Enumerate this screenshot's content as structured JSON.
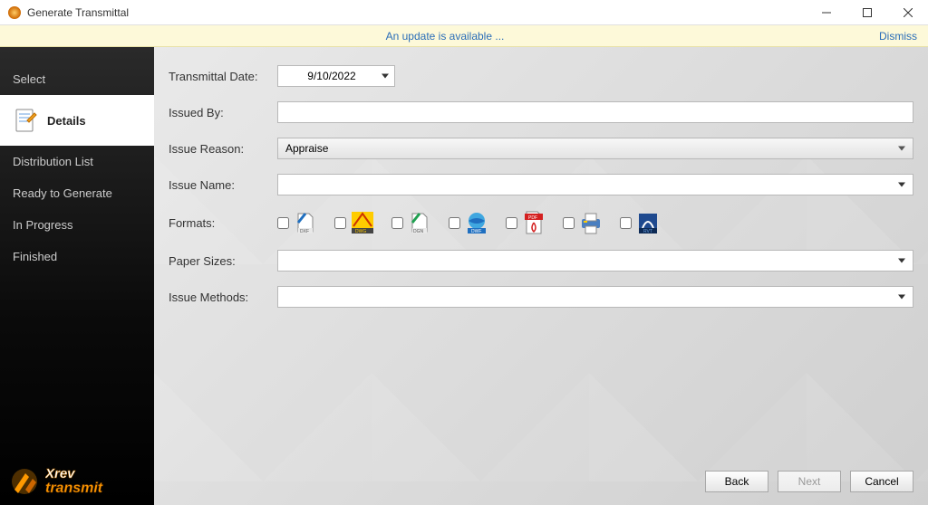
{
  "window": {
    "title": "Generate Transmittal"
  },
  "banner": {
    "message": "An update is available ...",
    "dismiss": "Dismiss"
  },
  "sidebar": {
    "steps": [
      {
        "label": "Select"
      },
      {
        "label": "Details",
        "active": true
      },
      {
        "label": "Distribution List"
      },
      {
        "label": "Ready to Generate"
      },
      {
        "label": "In Progress"
      },
      {
        "label": "Finished"
      }
    ],
    "logo_text": "Xrev transmit"
  },
  "form": {
    "transmittal_date_label": "Transmittal Date:",
    "transmittal_date_value": "9/10/2022",
    "issued_by_label": "Issued By:",
    "issued_by_value": "",
    "issue_reason_label": "Issue Reason:",
    "issue_reason_value": "Appraise",
    "issue_name_label": "Issue Name:",
    "issue_name_value": "",
    "formats_label": "Formats:",
    "formats": [
      {
        "name": "DXF",
        "checked": false
      },
      {
        "name": "DWG",
        "checked": false
      },
      {
        "name": "DGN",
        "checked": false
      },
      {
        "name": "DWF",
        "checked": false
      },
      {
        "name": "PDF",
        "checked": false
      },
      {
        "name": "Print",
        "checked": false
      },
      {
        "name": "RVT",
        "checked": false
      }
    ],
    "paper_sizes_label": "Paper Sizes:",
    "paper_sizes_value": "",
    "issue_methods_label": "Issue Methods:",
    "issue_methods_value": ""
  },
  "buttons": {
    "back": "Back",
    "next": "Next",
    "cancel": "Cancel"
  }
}
